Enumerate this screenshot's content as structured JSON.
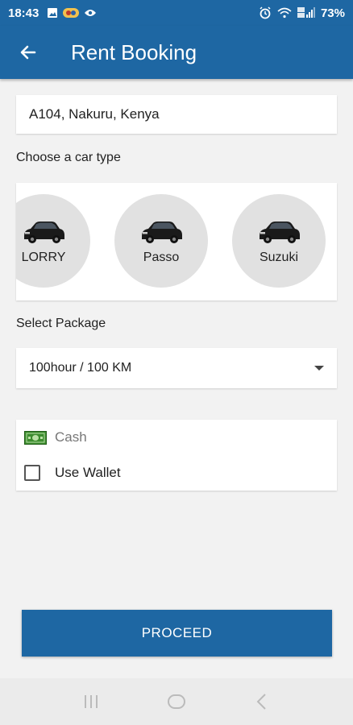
{
  "status_bar": {
    "time": "18:43",
    "battery": "73%",
    "icons": [
      "image-icon",
      "app-badge-icon",
      "eye-icon",
      "alarm-icon",
      "wifi-icon",
      "signal-icon"
    ]
  },
  "app_bar": {
    "title": "Rent Booking",
    "back_icon": "arrow-left-icon"
  },
  "address": "A104, Nakuru, Kenya",
  "car_type": {
    "label": "Choose a car type",
    "cars": [
      {
        "name": "LORRY"
      },
      {
        "name": "Passo"
      },
      {
        "name": "Suzuki"
      }
    ]
  },
  "package": {
    "label": "Select Package",
    "selected": "100hour / 100 KM"
  },
  "payment": {
    "cash_label": "Cash",
    "wallet_label": "Use Wallet",
    "wallet_checked": false
  },
  "proceed_label": "PROCEED",
  "colors": {
    "primary": "#1e67a3",
    "background": "#f2f2f2",
    "car_circle": "#e1e1e1",
    "cash_green": "#3c8c2e"
  },
  "nav_bar": {
    "icons": [
      "recent-apps-icon",
      "home-icon",
      "back-icon"
    ]
  }
}
